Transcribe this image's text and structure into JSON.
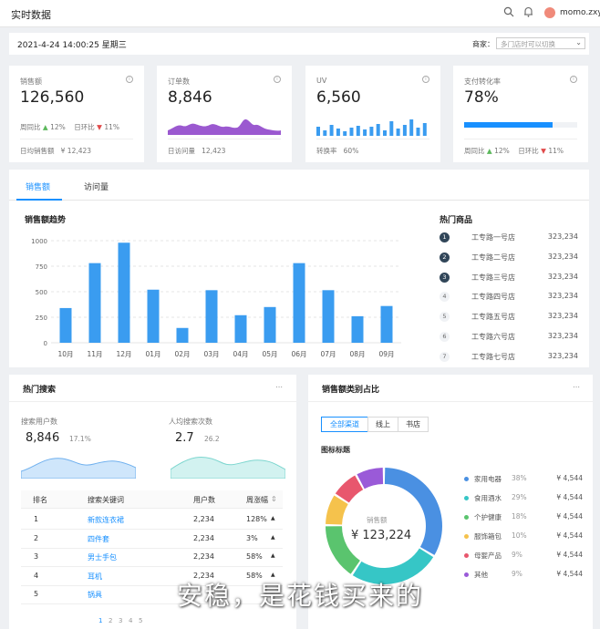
{
  "header": {
    "title": "实时数据",
    "user": "momo.zxy"
  },
  "datebar": {
    "datetime": "2021-4-24  14:00:25  星期三",
    "store_label": "商家：",
    "store_placeholder": "多门店时可以切换"
  },
  "cards": [
    {
      "label": "销售额",
      "value": "126,560",
      "wow_label": "周同比",
      "wow": "12%",
      "dod_label": "日环比",
      "dod": "11%",
      "footer_label": "日均销售额",
      "footer_value": "¥ 12,423"
    },
    {
      "label": "订单数",
      "value": "8,846",
      "footer_label": "日访问量",
      "footer_value": "12,423"
    },
    {
      "label": "UV",
      "value": "6,560",
      "footer_label": "转换率",
      "footer_value": "60%"
    },
    {
      "label": "支付转化率",
      "value": "78%",
      "progress": 0.78,
      "wow_label": "周同比",
      "wow": "12%",
      "dod_label": "日环比",
      "dod": "11%"
    }
  ],
  "sales": {
    "tabs": [
      "销售额",
      "访问量"
    ],
    "chart_title": "销售额趋势",
    "hot_title": "热门商品",
    "hot_items": [
      {
        "rank": "1",
        "name": "工专路一号店",
        "value": "323,234"
      },
      {
        "rank": "2",
        "name": "工专路二号店",
        "value": "323,234"
      },
      {
        "rank": "3",
        "name": "工专路三号店",
        "value": "323,234"
      },
      {
        "rank": "4",
        "name": "工专路四号店",
        "value": "323,234"
      },
      {
        "rank": "5",
        "name": "工专路五号店",
        "value": "323,234"
      },
      {
        "rank": "6",
        "name": "工专路六号店",
        "value": "323,234"
      },
      {
        "rank": "7",
        "name": "工专路七号店",
        "value": "323,234"
      }
    ]
  },
  "chart_data": {
    "type": "bar",
    "title": "销售额趋势",
    "categories": [
      "10月",
      "11月",
      "12月",
      "01月",
      "02月",
      "03月",
      "04月",
      "05月",
      "06月",
      "07月",
      "08月",
      "09月"
    ],
    "values": [
      340,
      780,
      980,
      520,
      145,
      515,
      270,
      350,
      780,
      515,
      260,
      360
    ],
    "yticks": [
      0,
      250,
      500,
      750,
      1000
    ],
    "ylim": [
      0,
      1000
    ],
    "grid": true,
    "color": "#3a9cf0"
  },
  "search": {
    "title": "热门搜索",
    "users_label": "搜索用户数",
    "users_value": "8,846",
    "users_change": "17.1%",
    "avg_label": "人均搜索次数",
    "avg_value": "2.7",
    "avg_change": "26.2",
    "columns": [
      "排名",
      "搜索关键词",
      "用户数",
      "周涨幅"
    ],
    "rows": [
      {
        "rank": "1",
        "keyword": "新款连衣裙",
        "users": "2,234",
        "change": "128%"
      },
      {
        "rank": "2",
        "keyword": "四件套",
        "users": "2,234",
        "change": "3%"
      },
      {
        "rank": "3",
        "keyword": "男士手包",
        "users": "2,234",
        "change": "58%"
      },
      {
        "rank": "4",
        "keyword": "耳机",
        "users": "2,234",
        "change": "58%"
      },
      {
        "rank": "5",
        "keyword": "锅具",
        "users": "",
        "change": ""
      }
    ],
    "pager": [
      "1",
      "2",
      "3",
      "4",
      "5"
    ]
  },
  "category": {
    "title": "销售额类别占比",
    "segments": [
      "全部渠道",
      "线上",
      "书店"
    ],
    "subtitle": "图标标题",
    "donut_label": "销售额",
    "donut_value": "¥ 123,224",
    "items": [
      {
        "name": "家用电器",
        "percent": "38%",
        "amount": "¥ 4,544",
        "color": "#4a90e2",
        "share": 0.38
      },
      {
        "name": "食用酒水",
        "percent": "29%",
        "amount": "¥ 4,544",
        "color": "#36c6c6",
        "share": 0.29
      },
      {
        "name": "个护健康",
        "percent": "18%",
        "amount": "¥ 4,544",
        "color": "#5ac46e",
        "share": 0.18
      },
      {
        "name": "服饰箱包",
        "percent": "10%",
        "amount": "¥ 4,544",
        "color": "#f5c24c",
        "share": 0.1
      },
      {
        "name": "母婴产品",
        "percent": "9%",
        "amount": "¥ 4,544",
        "color": "#e8576d",
        "share": 0.09
      },
      {
        "name": "其他",
        "percent": "9%",
        "amount": "¥ 4,544",
        "color": "#9a5ad8",
        "share": 0.09
      }
    ]
  },
  "caption": "安稳，是花钱买来的"
}
